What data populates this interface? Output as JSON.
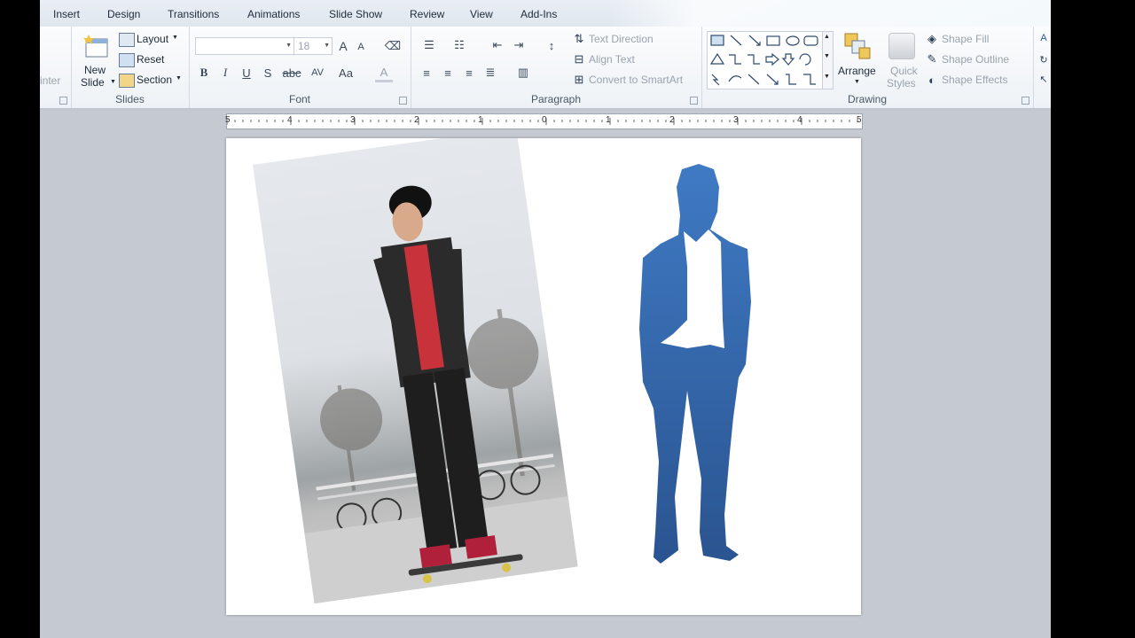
{
  "tabs": [
    "Insert",
    "Design",
    "Transitions",
    "Animations",
    "Slide Show",
    "Review",
    "View",
    "Add-Ins"
  ],
  "slides_group": {
    "clipped_label": "inter",
    "new_slide_line1": "New",
    "new_slide_line2": "Slide",
    "layout": "Layout",
    "reset": "Reset",
    "section": "Section",
    "label": "Slides"
  },
  "font_group": {
    "font_name": "",
    "font_size": "18",
    "grow": "A",
    "shrink": "A",
    "bold": "B",
    "italic": "I",
    "underline": "U",
    "shadow": "S",
    "strike": "abc",
    "spacing": "AV",
    "case": "Aa",
    "color": "A",
    "label": "Font"
  },
  "paragraph_group": {
    "text_direction": "Text Direction",
    "align_text": "Align Text",
    "convert_smartart": "Convert to SmartArt",
    "label": "Paragraph"
  },
  "drawing_group": {
    "arrange": "Arrange",
    "quick_styles_1": "Quick",
    "quick_styles_2": "Styles",
    "shape_fill": "Shape Fill",
    "shape_outline": "Shape Outline",
    "shape_effects": "Shape Effects",
    "label": "Drawing"
  },
  "ruler": {
    "ticks": [
      "5",
      "4",
      "3",
      "2",
      "1",
      "0",
      "1",
      "2",
      "3",
      "4",
      "5"
    ]
  },
  "colors": {
    "silhouette_top": "#3f7ac4",
    "silhouette_bottom": "#2a5490",
    "accent": "#2b579a"
  }
}
